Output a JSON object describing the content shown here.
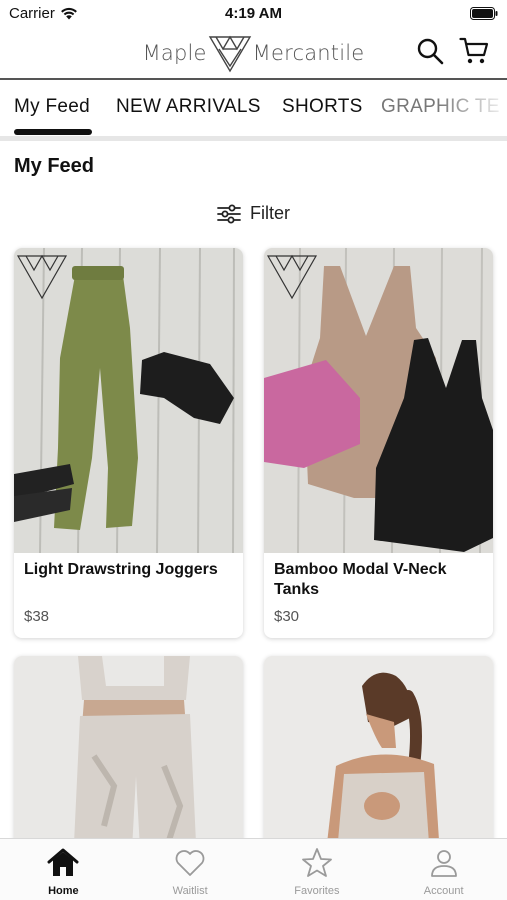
{
  "status_bar": {
    "carrier": "Carrier",
    "time": "4:19 AM"
  },
  "header": {
    "logo_left": "Maple",
    "logo_right": "Mercantile",
    "search_icon": "search-icon",
    "cart_icon": "cart-icon"
  },
  "tabs": [
    {
      "label": "My Feed",
      "active": true
    },
    {
      "label": "NEW ARRIVALS",
      "active": false
    },
    {
      "label": "SHORTS",
      "active": false
    },
    {
      "label": "GRAPHIC TE",
      "active": false
    }
  ],
  "feed": {
    "title": "My Feed",
    "filter_label": "Filter",
    "filter_icon": "sliders-icon"
  },
  "products": [
    {
      "name": "Light Drawstring Joggers",
      "price": "$38",
      "image": "olive-joggers-photo"
    },
    {
      "name": "Bamboo Modal V-Neck Tanks",
      "price": "$30",
      "image": "vneck-tanks-photo"
    },
    {
      "name": "",
      "price": "",
      "image": "tie-dye-leggings-photo"
    },
    {
      "name": "",
      "price": "",
      "image": "cutout-sports-bra-photo"
    }
  ],
  "tabbar": [
    {
      "label": "Home",
      "icon": "home-icon",
      "active": true
    },
    {
      "label": "Waitlist",
      "icon": "heart-icon",
      "active": false
    },
    {
      "label": "Favorites",
      "icon": "star-icon",
      "active": false
    },
    {
      "label": "Account",
      "icon": "person-icon",
      "active": false
    }
  ],
  "colors": {
    "accent": "#111111",
    "inactive": "#9a9a9a",
    "divider": "#555555",
    "card_bg": "#ffffff"
  }
}
